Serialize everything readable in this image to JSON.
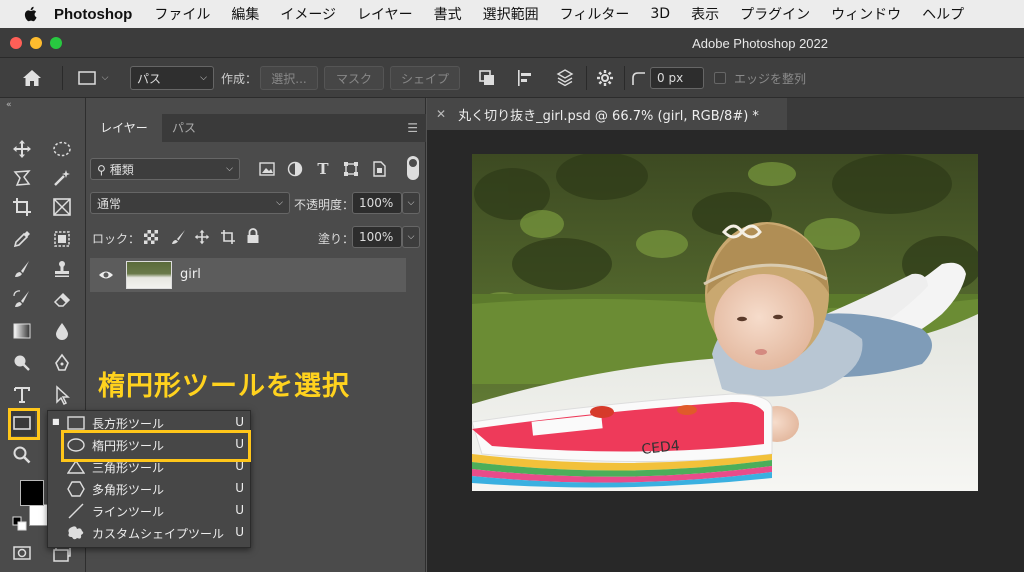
{
  "menubar": {
    "app": "Photoshop",
    "items": [
      "ファイル",
      "編集",
      "イメージ",
      "レイヤー",
      "書式",
      "選択範囲",
      "フィルター",
      "3D",
      "表示",
      "プラグイン",
      "ウィンドウ",
      "ヘルプ"
    ]
  },
  "window": {
    "title": "Adobe Photoshop 2022"
  },
  "options": {
    "mode": "パス",
    "create_label": "作成：",
    "select_btn": "選択...",
    "mask_btn": "マスク",
    "shape_btn": "シェイプ",
    "radius": "0 px",
    "align_edges": "エッジを整列"
  },
  "layers_panel": {
    "tabs": [
      "レイヤー",
      "パス"
    ],
    "filter": "種類",
    "blend_mode": "通常",
    "opacity_label": "不透明度：",
    "opacity_value": "100%",
    "lock_label": "ロック：",
    "fill_label": "塗り：",
    "fill_value": "100%",
    "layer_name": "girl"
  },
  "document": {
    "tab_title": "丸く切り抜き_girl.psd @ 66.7% (girl, RGB/8#) *"
  },
  "annotation": "楕円形ツールを選択",
  "flyout": {
    "items": [
      {
        "label": "長方形ツール",
        "key": "U",
        "icon": "rectangle-icon"
      },
      {
        "label": "楕円形ツール",
        "key": "U",
        "icon": "ellipse-icon"
      },
      {
        "label": "三角形ツール",
        "key": "U",
        "icon": "triangle-icon"
      },
      {
        "label": "多角形ツール",
        "key": "U",
        "icon": "polygon-icon"
      },
      {
        "label": "ラインツール",
        "key": "U",
        "icon": "line-icon"
      },
      {
        "label": "カスタムシェイプツール",
        "key": "U",
        "icon": "custom-shape-icon"
      }
    ]
  },
  "colors": {
    "highlight": "#ffc61a",
    "annotation": "#ffd21e"
  }
}
